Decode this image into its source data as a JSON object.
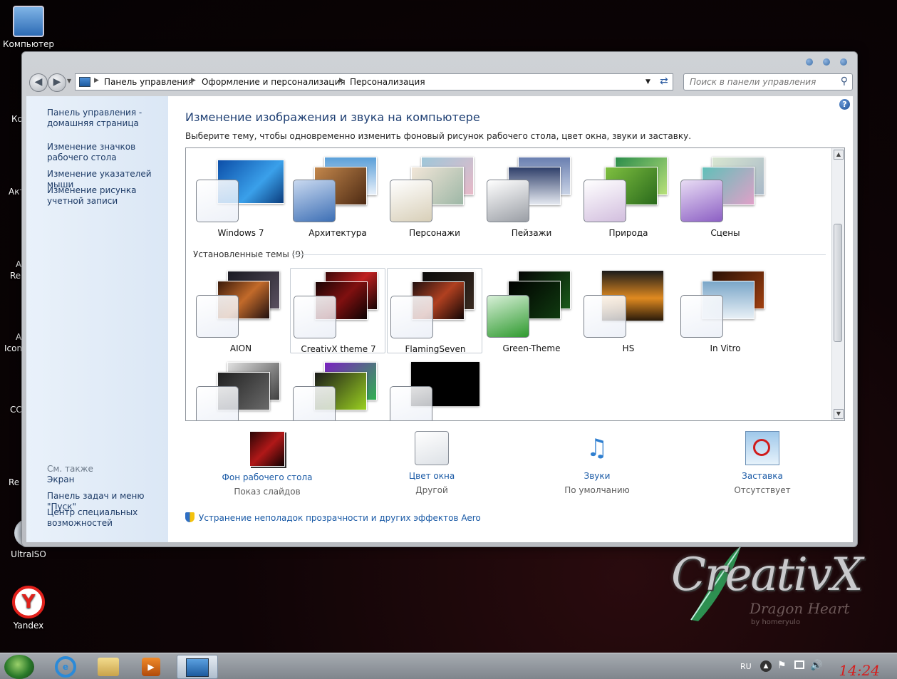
{
  "desktop": {
    "icons": [
      {
        "name": "computer",
        "label": "Компьютер"
      },
      {
        "name": "ultraiso",
        "label": "UltraISO"
      },
      {
        "name": "yandex",
        "label": "Yandex"
      }
    ],
    "partial_labels": [
      "Ко",
      "Акт",
      "A",
      "Re",
      "A",
      "Icon",
      "CC",
      "Re"
    ]
  },
  "logo": {
    "script": "CreativX",
    "sub": "Dragon Heart",
    "byline": "by homeryulo"
  },
  "window": {
    "breadcrumb": [
      "Панель управления",
      "Оформление и персонализация",
      "Персонализация"
    ],
    "search_placeholder": "Поиск в панели управления",
    "left_links": [
      "Панель управления - домашняя страница",
      "Изменение значков рабочего стола",
      "Изменение указателей мыши",
      "Изменение рисунка учетной записи"
    ],
    "see_also_title": "См. также",
    "see_also": [
      "Экран",
      "Панель задач и меню \"Пуск\"",
      "Центр специальных возможностей"
    ],
    "heading": "Изменение изображения и звука на компьютере",
    "subheading": "Выберите тему, чтобы одновременно изменить фоновый рисунок рабочего стола, цвет окна, звуки и заставку.",
    "aero_themes": [
      "Windows 7",
      "Архитектура",
      "Персонажи",
      "Пейзажи",
      "Природа",
      "Сцены"
    ],
    "installed_title": "Установленные темы (9)",
    "installed_themes": [
      "AION",
      "CreativX theme 7",
      "FlamingSeven",
      "Green-Theme",
      "HS",
      "In Vitro",
      "",
      "",
      ""
    ],
    "bottom": [
      {
        "title": "Фон рабочего стола",
        "value": "Показ слайдов"
      },
      {
        "title": "Цвет окна",
        "value": "Другой"
      },
      {
        "title": "Звуки",
        "value": "По умолчанию"
      },
      {
        "title": "Заставка",
        "value": "Отсутствует"
      }
    ],
    "aero_link": "Устранение неполадок прозрачности и других эффектов Aero"
  },
  "taskbar": {
    "lang": "RU",
    "clock": "14:24"
  }
}
